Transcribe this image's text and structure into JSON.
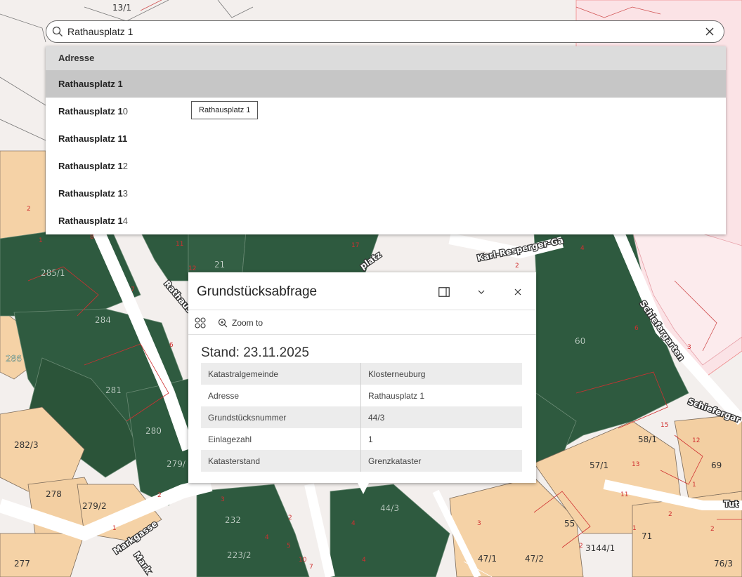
{
  "search": {
    "value": "Rathausplatz 1"
  },
  "suggestions": {
    "header": "Adresse",
    "items": [
      {
        "bold": "Rathausplatz 1",
        "rest": ""
      },
      {
        "bold": "Rathausplatz 1",
        "rest": "0"
      },
      {
        "bold": "Rathausplatz 1",
        "rest": "1"
      },
      {
        "bold": "Rathausplatz 1",
        "rest": "2"
      },
      {
        "bold": "Rathausplatz 1",
        "rest": "3"
      },
      {
        "bold": "Rathausplatz 1",
        "rest": "4"
      }
    ],
    "tooltip": "Rathausplatz 1"
  },
  "popup": {
    "title": "Grundstücksabfrage",
    "zoom_label": "Zoom to",
    "stand": "Stand: 23.11.2025",
    "rows": [
      {
        "key": "Katastralgemeinde",
        "value": "Klosterneuburg"
      },
      {
        "key": "Adresse",
        "value": "Rathausplatz 1"
      },
      {
        "key": "Grundstücksnummer",
        "value": "44/3"
      },
      {
        "key": "Einlagezahl",
        "value": "1"
      },
      {
        "key": "Katasterstand",
        "value": "Grenzkataster"
      }
    ]
  },
  "map": {
    "colors": {
      "dark_green": "#2e5a3f",
      "beige": "#f5d2a6",
      "pink": "#fce6e8",
      "white_road": "#ffffff"
    },
    "plots_dark": [
      "285/1",
      "284",
      "286",
      "281",
      "280",
      "279/",
      "232",
      "223/2",
      "44/3",
      "60",
      "21"
    ],
    "plots_light": [
      "282/3",
      "278",
      "279/2",
      "277",
      "57/1",
      "58/1",
      "69",
      "55",
      "71",
      "47/1",
      "47/2",
      "3144/1",
      "76/3",
      "13/1"
    ],
    "numbers": [
      "2",
      "1",
      "8",
      "7",
      "6",
      "11",
      "12",
      "17",
      "4",
      "2",
      "6",
      "3",
      "15",
      "12",
      "13",
      "11",
      "1",
      "2",
      "2",
      "3",
      "1",
      "2",
      "4",
      "5",
      "10",
      "7",
      "4",
      "4",
      "3",
      "1",
      "2",
      "2"
    ],
    "streets": [
      "Karl-Resperger-Ga",
      "Schiefergarten",
      "Schiefergar",
      "Rathaus",
      "Markgasse",
      "Mark",
      "platz",
      "Tut"
    ]
  }
}
